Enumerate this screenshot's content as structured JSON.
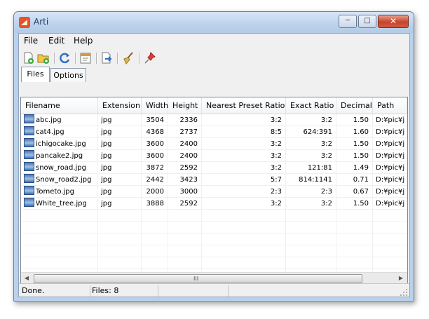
{
  "window": {
    "title": "Arti",
    "minimize_glyph": "─",
    "maximize_glyph": "□",
    "close_glyph": "✕"
  },
  "menu": [
    "File",
    "Edit",
    "Help"
  ],
  "toolbar": [
    "add-file-icon",
    "add-folder-icon",
    "refresh-icon",
    "properties-icon",
    "export-icon",
    "clear-broom-icon",
    "pin-icon"
  ],
  "tabs": [
    "Files",
    "Options"
  ],
  "table": {
    "columns": [
      "Filename",
      "Extension",
      "Width",
      "Height",
      "Nearest Preset Ratio",
      "Exact Ratio",
      "Decimal",
      "Path"
    ],
    "rows": [
      [
        "abc.jpg",
        "jpg",
        "3504",
        "2336",
        "3:2",
        "3:2",
        "1.50",
        "D:¥pic¥j"
      ],
      [
        "cat4.jpg",
        "jpg",
        "4368",
        "2737",
        "8:5",
        "624:391",
        "1.60",
        "D:¥pic¥j"
      ],
      [
        "ichigocake.jpg",
        "jpg",
        "3600",
        "2400",
        "3:2",
        "3:2",
        "1.50",
        "D:¥pic¥j"
      ],
      [
        "pancake2.jpg",
        "jpg",
        "3600",
        "2400",
        "3:2",
        "3:2",
        "1.50",
        "D:¥pic¥j"
      ],
      [
        "snow_road.jpg",
        "jpg",
        "3872",
        "2592",
        "3:2",
        "121:81",
        "1.49",
        "D:¥pic¥j"
      ],
      [
        "Snow_road2.jpg",
        "jpg",
        "2442",
        "3423",
        "5:7",
        "814:1141",
        "0.71",
        "D:¥pic¥j"
      ],
      [
        "Tometo.jpg",
        "jpg",
        "2000",
        "3000",
        "2:3",
        "2:3",
        "0.67",
        "D:¥pic¥j"
      ],
      [
        "White_tree.jpg",
        "jpg",
        "3888",
        "2592",
        "3:2",
        "3:2",
        "1.50",
        "D:¥pic¥j"
      ]
    ]
  },
  "scrollbar": {
    "left_arrow": "◀",
    "right_arrow": "▶",
    "grip": "III"
  },
  "status": {
    "state": "Done.",
    "files": "Files: 8"
  },
  "colors": {
    "title_text": "#1e395b",
    "close_button": "#c7432b",
    "image_icon": "#4a74b8"
  }
}
